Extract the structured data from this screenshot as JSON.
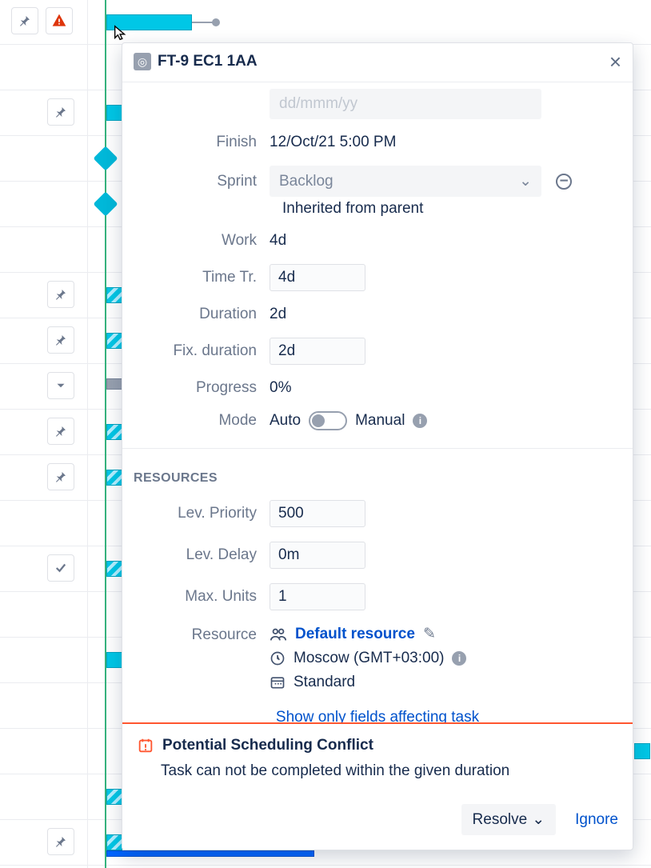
{
  "header": {
    "issue_key": "FT-9 EC1 1AA"
  },
  "fields": {
    "finish_label": "Finish",
    "finish_value": "12/Oct/21 5:00 PM",
    "sprint_label": "Sprint",
    "sprint_value": "Backlog",
    "sprint_inherited": "Inherited from parent",
    "work_label": "Work",
    "work_value": "4d",
    "timetr_label": "Time Tr.",
    "timetr_value": "4d",
    "duration_label": "Duration",
    "duration_value": "2d",
    "fixdur_label": "Fix. duration",
    "fixdur_value": "2d",
    "progress_label": "Progress",
    "progress_value": "0%",
    "mode_label": "Mode",
    "mode_auto": "Auto",
    "mode_manual": "Manual"
  },
  "resources": {
    "section": "RESOURCES",
    "levprio_label": "Lev. Priority",
    "levprio_value": "500",
    "levdelay_label": "Lev. Delay",
    "levdelay_value": "0m",
    "maxunits_label": "Max. Units",
    "maxunits_value": "1",
    "resource_label": "Resource",
    "resource_name": "Default resource",
    "resource_tz": "Moscow (GMT+03:00)",
    "resource_cal": "Standard"
  },
  "footer": {
    "show_link": "Show only fields affecting task"
  },
  "conflict": {
    "title": "Potential Scheduling Conflict",
    "message": "Task can not be completed within the given duration",
    "resolve": "Resolve",
    "ignore": "Ignore"
  }
}
